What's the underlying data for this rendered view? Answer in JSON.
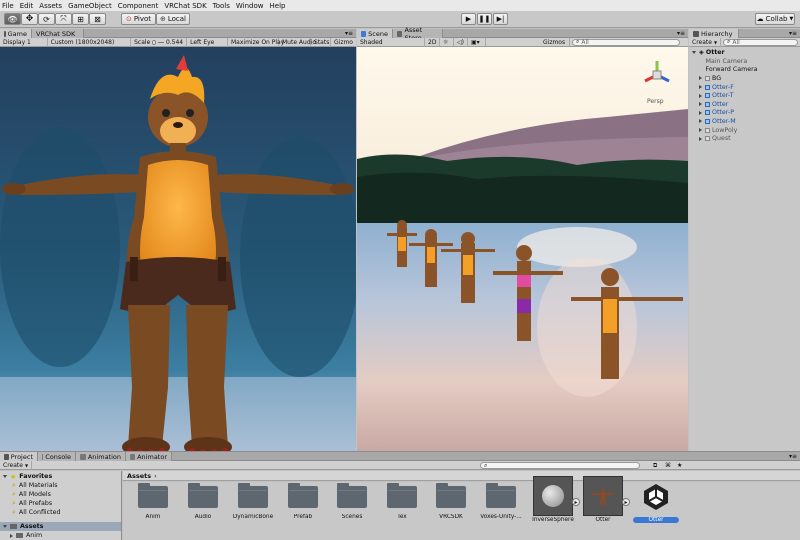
{
  "menu": [
    "File",
    "Edit",
    "Assets",
    "GameObject",
    "Component",
    "VRChat SDK",
    "Tools",
    "Window",
    "Help"
  ],
  "toolbar": {
    "pivot_label": "Pivot",
    "local_label": "Local",
    "collab_label": "Collab"
  },
  "game_view": {
    "tabs": [
      "Game",
      "VRChat SDK"
    ],
    "display": "Display 1",
    "resolution": "Custom (1800x2048)",
    "scale_label": "Scale",
    "scale_value": "0.544",
    "left_eye": "Left Eye",
    "maximize": "Maximize On Play",
    "mute": "Mute Audio",
    "stats": "Stats",
    "gizmos": "Gizmo"
  },
  "scene_view": {
    "tabs": [
      "Scene",
      "Asset Store"
    ],
    "shading": "Shaded",
    "mode_2d": "2D",
    "gizmos": "Gizmos",
    "search": "All",
    "persp": "Persp"
  },
  "hierarchy": {
    "tab": "Hierarchy",
    "create": "Create",
    "search": "All",
    "scene": "Otter",
    "items": [
      {
        "label": "Main Camera",
        "color": "#555555",
        "expand": false,
        "indent": 1,
        "icon": "none"
      },
      {
        "label": "Forward Camera",
        "color": "#111111",
        "expand": false,
        "indent": 1,
        "icon": "none"
      },
      {
        "label": "BG",
        "color": "#111111",
        "expand": true,
        "indent": 1,
        "icon": "gray"
      },
      {
        "label": "Otter-F",
        "color": "#1a4fa0",
        "expand": true,
        "indent": 1,
        "icon": "blue"
      },
      {
        "label": "Otter-T",
        "color": "#1a4fa0",
        "expand": true,
        "indent": 1,
        "icon": "blue"
      },
      {
        "label": "Otter",
        "color": "#1a4fa0",
        "expand": true,
        "indent": 1,
        "icon": "blue"
      },
      {
        "label": "Otter-P",
        "color": "#1a4fa0",
        "expand": true,
        "indent": 1,
        "icon": "blue"
      },
      {
        "label": "Otter-M",
        "color": "#1a4fa0",
        "expand": true,
        "indent": 1,
        "icon": "blue"
      },
      {
        "label": "LowPoly",
        "color": "#555555",
        "expand": true,
        "indent": 1,
        "icon": "gray"
      },
      {
        "label": "Quest",
        "color": "#555555",
        "expand": true,
        "indent": 1,
        "icon": "gray"
      }
    ]
  },
  "bottom": {
    "tabs": [
      "Project",
      "Console",
      "Animation",
      "Animator"
    ],
    "create": "Create",
    "breadcrumb": "Assets",
    "favorites_label": "Favorites",
    "favorites": [
      "All Materials",
      "All Models",
      "All Prefabs",
      "All Conflicted"
    ],
    "assets_root": "Assets",
    "assets_child": "Anim",
    "assets": [
      "Anim",
      "Audio",
      "DynamicBone",
      "Prefab",
      "Scenes",
      "Tex",
      "VRCSDK",
      "Voxes-Unity-...",
      "InverseSphere",
      "Otter",
      "Otter"
    ]
  }
}
